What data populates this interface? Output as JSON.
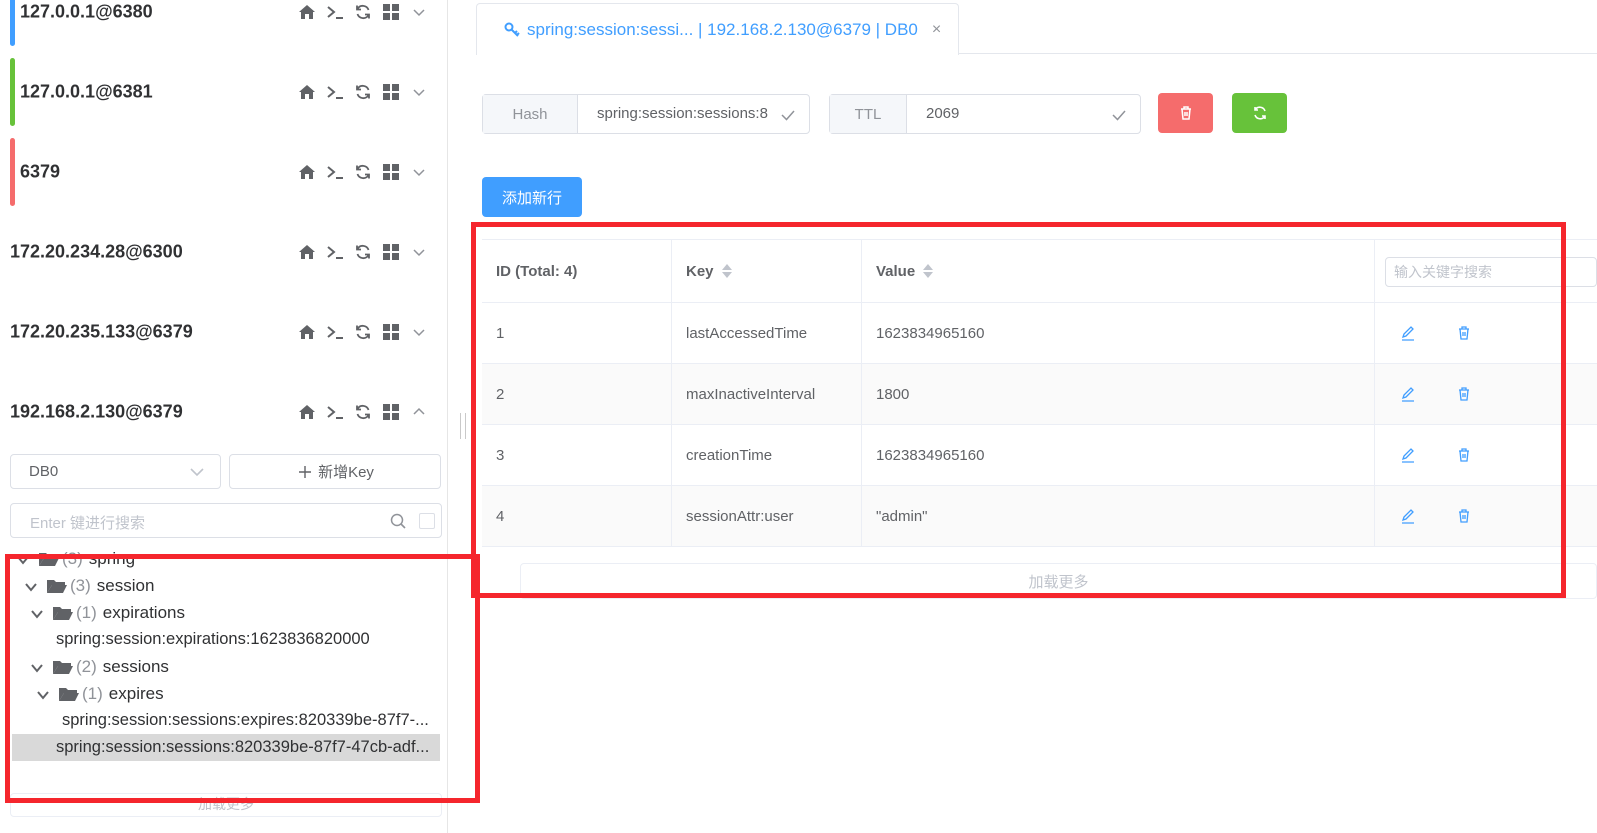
{
  "connections": [
    {
      "name": "127.0.0.1@6380",
      "color": "#409eff",
      "expanded": false
    },
    {
      "name": "127.0.0.1@6381",
      "color": "#67c23a",
      "expanded": false
    },
    {
      "name": "6379",
      "color": "#f56c6c",
      "expanded": false
    },
    {
      "name": "172.20.234.28@6300",
      "color": "",
      "expanded": false
    },
    {
      "name": "172.20.235.133@6379",
      "color": "",
      "expanded": false
    },
    {
      "name": "192.168.2.130@6379",
      "color": "",
      "expanded": true
    }
  ],
  "connection_icons": [
    "home-icon",
    "terminal-icon",
    "refresh-icon",
    "grid-icon",
    "chevron-icon"
  ],
  "db_select": {
    "value": "DB0"
  },
  "new_key_button": {
    "label": "新增Key"
  },
  "key_search": {
    "placeholder": "Enter 键进行搜索"
  },
  "tree": {
    "nodes": [
      {
        "count": "(3)",
        "label": "spring"
      },
      {
        "count": "(3)",
        "label": "session"
      },
      {
        "count": "(1)",
        "label": "expirations"
      },
      {
        "count": "(2)",
        "label": "sessions"
      },
      {
        "count": "(1)",
        "label": "expires"
      }
    ],
    "leaves": [
      "spring:session:expirations:1623836820000",
      "spring:session:sessions:expires:820339be-87f7-...",
      "spring:session:sessions:820339be-87f7-47cb-adf..."
    ],
    "load_more": "加载更多"
  },
  "tab": {
    "title": "spring:session:sessi... | 192.168.2.130@6379 | DB0",
    "close": "×"
  },
  "key_type": {
    "label": "Hash",
    "value": "spring:session:sessions:8"
  },
  "ttl": {
    "label": "TTL",
    "value": "2069"
  },
  "add_row_button": {
    "label": "添加新行"
  },
  "table": {
    "headers": {
      "id": "ID (Total: 4)",
      "key": "Key",
      "value": "Value"
    },
    "search_placeholder": "输入关键字搜索",
    "rows": [
      {
        "id": "1",
        "key": "lastAccessedTime",
        "value": "1623834965160"
      },
      {
        "id": "2",
        "key": "maxInactiveInterval",
        "value": "1800"
      },
      {
        "id": "3",
        "key": "creationTime",
        "value": "1623834965160"
      },
      {
        "id": "4",
        "key": "sessionAttr:user",
        "value": "\"admin\""
      }
    ],
    "load_more": "加载更多"
  },
  "colors": {
    "primary": "#409eff",
    "danger": "#f56c6c",
    "success": "#67c23a",
    "highlight_box": "#f5262d"
  }
}
